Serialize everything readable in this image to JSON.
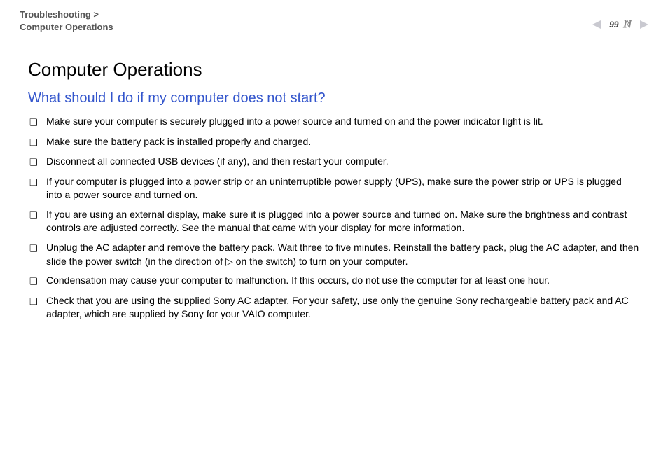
{
  "header": {
    "breadcrumb_line1": "Troubleshooting >",
    "breadcrumb_line2": "Computer Operations",
    "page_number": "99",
    "n_suffix": "N"
  },
  "content": {
    "heading": "Computer Operations",
    "subheading": "What should I do if my computer does not start?",
    "bullet_glyph": "❑",
    "items": [
      "Make sure your computer is securely plugged into a power source and turned on and the power indicator light is lit.",
      "Make sure the battery pack is installed properly and charged.",
      "Disconnect all connected USB devices (if any), and then restart your computer.",
      "If your computer is plugged into a power strip or an uninterruptible power supply (UPS), make sure the power strip or UPS is plugged into a power source and turned on.",
      "If you are using an external display, make sure it is plugged into a power source and turned on. Make sure the brightness and contrast controls are adjusted correctly. See the manual that came with your display for more information.",
      "Unplug the AC adapter and remove the battery pack. Wait three to five minutes. Reinstall the battery pack, plug the AC adapter, and then slide the power switch (in the direction of ▷ on the switch) to turn on your computer.",
      "Condensation may cause your computer to malfunction. If this occurs, do not use the computer for at least one hour.",
      "Check that you are using the supplied Sony AC adapter. For your safety, use only the genuine Sony rechargeable battery pack and AC adapter, which are supplied by Sony for your VAIO computer."
    ]
  }
}
